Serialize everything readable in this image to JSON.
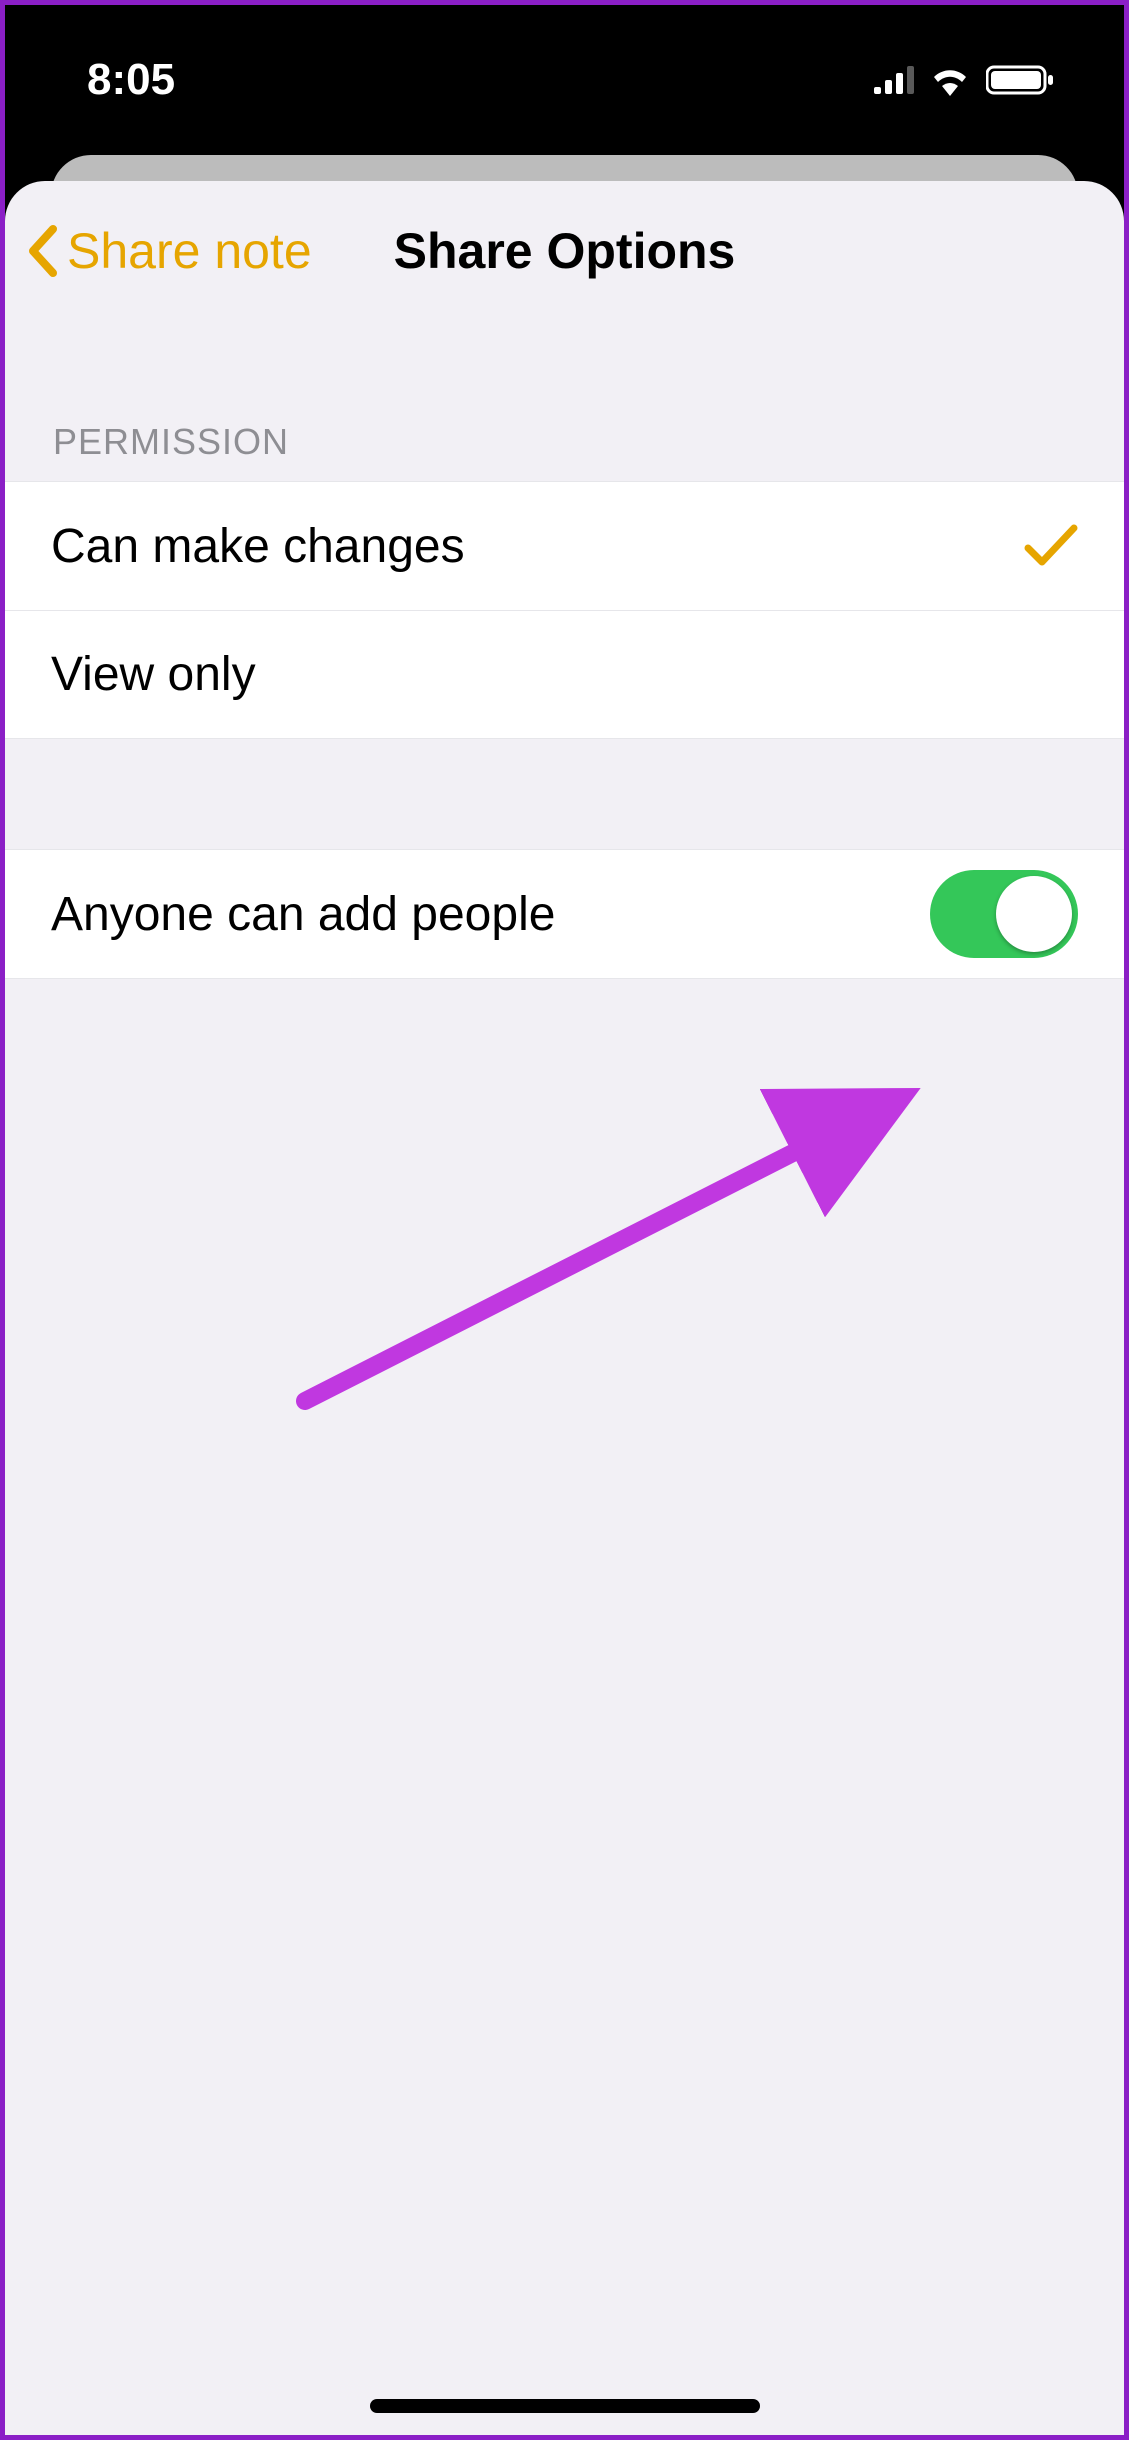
{
  "status": {
    "time": "8:05"
  },
  "nav": {
    "back_label": "Share note",
    "title": "Share Options"
  },
  "permission": {
    "header": "PERMISSION",
    "options": [
      {
        "label": "Can make changes",
        "selected": true
      },
      {
        "label": "View only",
        "selected": false
      }
    ]
  },
  "add_people": {
    "label": "Anyone can add people",
    "enabled": true
  }
}
